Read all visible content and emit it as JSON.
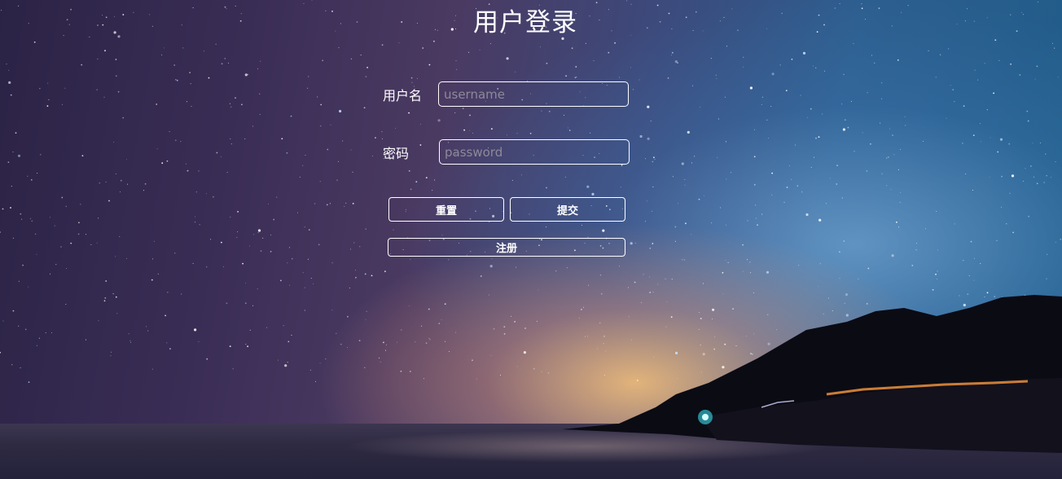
{
  "page": {
    "title": "用户登录"
  },
  "form": {
    "username": {
      "label": "用户名",
      "placeholder": "username",
      "value": ""
    },
    "password": {
      "label": "密码",
      "placeholder": "password",
      "value": ""
    },
    "buttons": {
      "reset_label": "重置",
      "submit_label": "提交",
      "register_label": "注册"
    }
  },
  "colors": {
    "text": "#ffffff",
    "border": "#ffffff",
    "placeholder": "#8d8a99"
  }
}
